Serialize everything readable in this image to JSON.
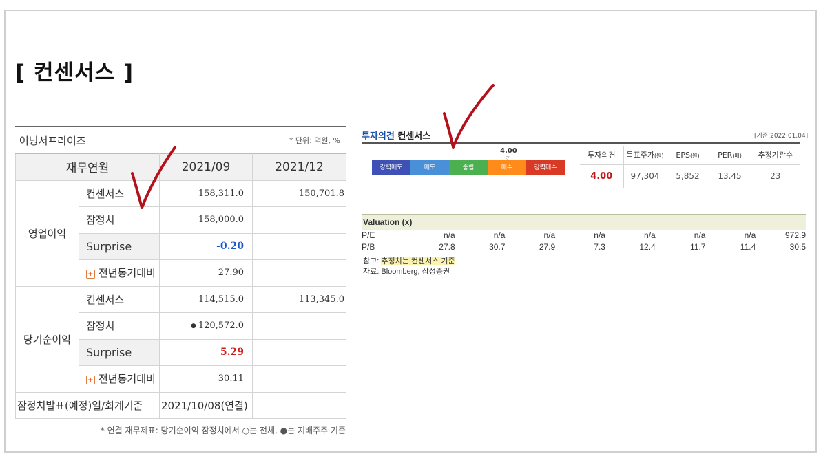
{
  "page_title": "[ 컨센서스 ]",
  "earnings": {
    "title": "어닝서프라이즈",
    "unit_note": "* 단위: 억원, %",
    "header": {
      "row_label": "재무연월",
      "col1": "2021/09",
      "col2": "2021/12"
    },
    "operating": {
      "group": "영업이익",
      "rows": [
        {
          "label": "컨센서스",
          "v1": "158,311.0",
          "v2": "150,701.8"
        },
        {
          "label": "잠정치",
          "v1": "158,000.0",
          "v2": ""
        },
        {
          "label": "Surprise",
          "v1": "-0.20",
          "v2": ""
        },
        {
          "label": "전년동기대비",
          "v1": "27.90",
          "v2": ""
        }
      ]
    },
    "net": {
      "group": "당기순이익",
      "rows": [
        {
          "label": "컨센서스",
          "v1": "114,515.0",
          "v2": "113,345.0"
        },
        {
          "label": "잠정치",
          "v1": "120,572.0",
          "v2": ""
        },
        {
          "label": "Surprise",
          "v1": "5.29",
          "v2": ""
        },
        {
          "label": "전년동기대비",
          "v1": "30.11",
          "v2": ""
        }
      ]
    },
    "footer": {
      "label": "잠정치발표(예정)일/회계기준",
      "value": "2021/10/08(연결)"
    },
    "note": "* 연결 재무제표: 당기순이익 잠정치에서 ○는 전체, ●는 지배주주 기준"
  },
  "opinion": {
    "title_accent": "투자의견",
    "title_rest": " 컨센서스",
    "date": "[기준:2022.01.04]",
    "score": "4.00",
    "rating_labels": [
      "강력매도",
      "매도",
      "중립",
      "매수",
      "강력매수"
    ],
    "rating_colors": [
      "#3f51b5",
      "#4a90d9",
      "#4caf50",
      "#ff8c1a",
      "#d83a26"
    ],
    "headers": [
      "투자의견",
      "목표주가",
      "EPS",
      "PER",
      "추정기관수"
    ],
    "header_units": [
      "",
      "(원)",
      "(원)",
      "(배)",
      ""
    ],
    "values": [
      "4.00",
      "97,304",
      "5,852",
      "13.45",
      "23"
    ]
  },
  "valuation": {
    "title": "Valuation (x)",
    "rows": [
      {
        "label": "P/E",
        "values": [
          "n/a",
          "n/a",
          "n/a",
          "n/a",
          "n/a",
          "n/a",
          "n/a",
          "972.9"
        ]
      },
      {
        "label": "P/B",
        "values": [
          "27.8",
          "30.7",
          "27.9",
          "7.3",
          "12.4",
          "11.7",
          "11.4",
          "30.5"
        ]
      }
    ],
    "note_prefix": "참고: ",
    "note_highlight": "추정치는 컨센서스 기준",
    "source": "자료: Bloomberg, 삼성증권"
  }
}
